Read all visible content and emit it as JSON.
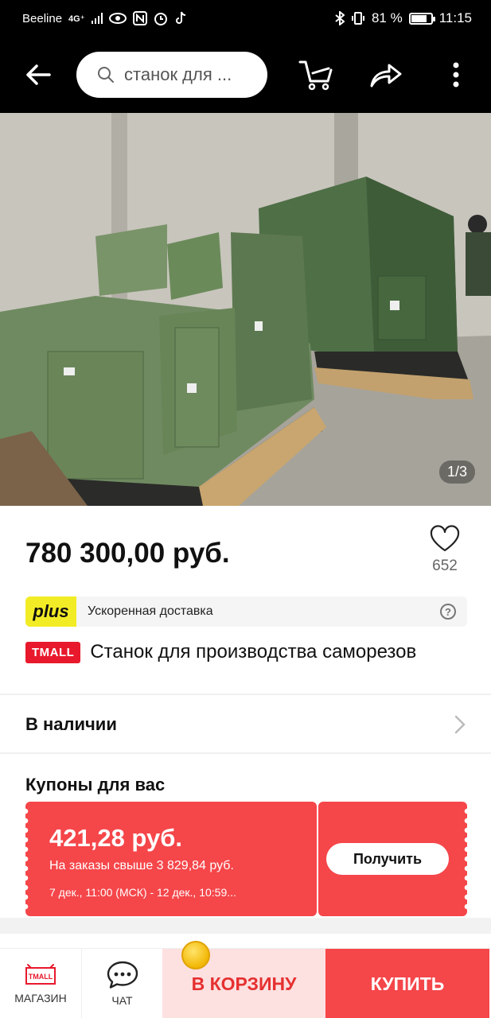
{
  "status_bar": {
    "carrier": "Beeline",
    "network": "4G⁺",
    "battery": "81 %",
    "battery_fraction": 0.81,
    "time": "11:15"
  },
  "header": {
    "search_text": "станок для ..."
  },
  "gallery": {
    "counter": "1/3"
  },
  "product": {
    "price": "780 300,00 руб.",
    "favorites_count": "652",
    "plus_label": "plus",
    "delivery_text": "Ускоренная доставка",
    "store_badge": "TMALL",
    "title": "Станок для производства саморезов"
  },
  "availability": {
    "label": "В наличии"
  },
  "coupons": {
    "section_title": "Купоны для вас",
    "amount": "421,28 руб.",
    "condition": "На заказы свыше 3 829,84 руб.",
    "dates": "7 дек., 11:00 (МСК) - 12 дек., 10:59...",
    "get_label": "Получить"
  },
  "bottom_bar": {
    "store_icon_text": "TMALL",
    "store_label": "МАГАЗИН",
    "chat_label": "ЧАТ",
    "cart_label": "В КОРЗИНУ",
    "buy_label": "КУПИТЬ"
  },
  "colors": {
    "accent_red": "#f5464a",
    "plus_yellow": "#f2ec26",
    "tmall_red": "#e8192c"
  }
}
